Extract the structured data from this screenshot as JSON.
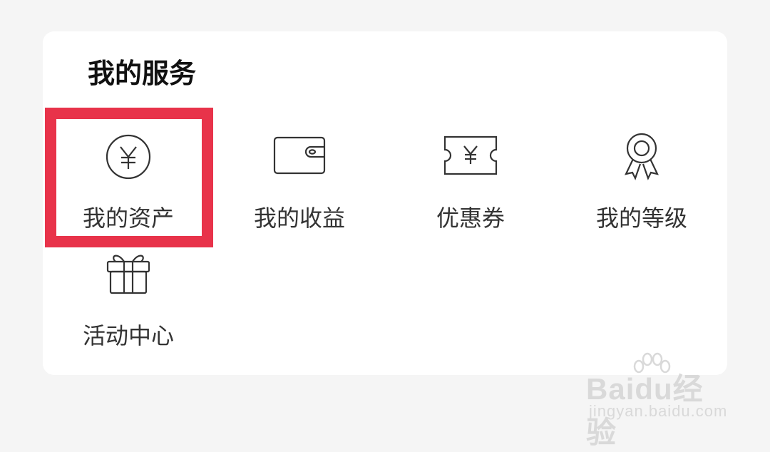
{
  "section_title": "我的服务",
  "services": [
    {
      "label": "我的资产",
      "icon": "yen-coin-icon"
    },
    {
      "label": "我的收益",
      "icon": "wallet-icon"
    },
    {
      "label": "优惠券",
      "icon": "yen-ticket-icon"
    },
    {
      "label": "我的等级",
      "icon": "medal-icon"
    },
    {
      "label": "活动中心",
      "icon": "gift-icon"
    }
  ],
  "highlight_color": "#e8334a",
  "watermark": {
    "logo": "Baidu经验",
    "url": "jingyan.baidu.com"
  }
}
